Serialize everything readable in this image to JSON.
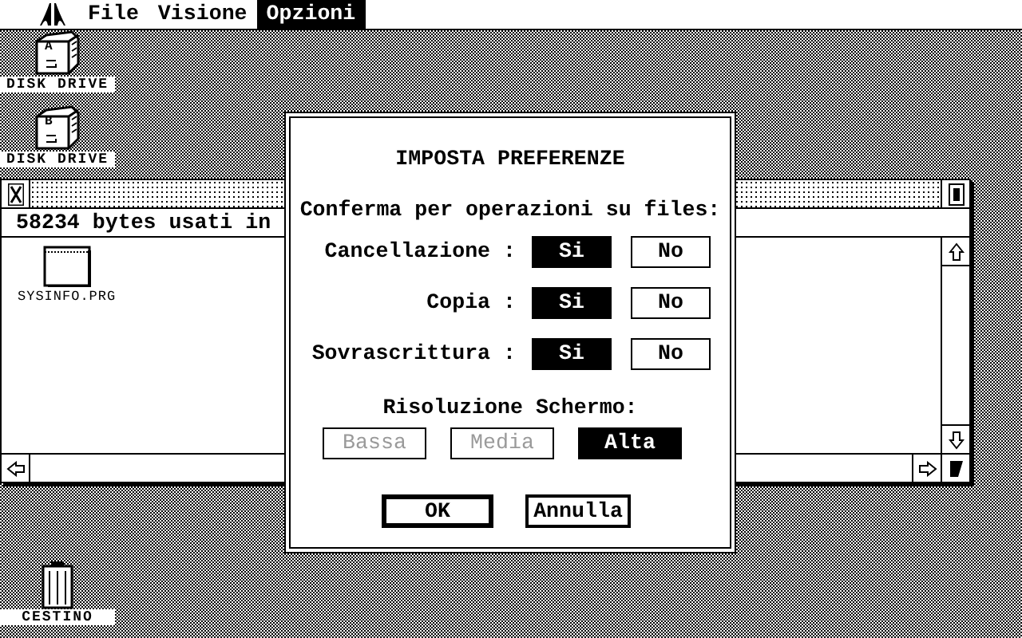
{
  "menu": [
    {
      "label": "File",
      "selected": false
    },
    {
      "label": "Visione",
      "selected": false
    },
    {
      "label": "Opzioni",
      "selected": true
    }
  ],
  "desktop_icons": [
    {
      "kind": "drive",
      "letter": "A",
      "label": "DISK DRIVE"
    },
    {
      "kind": "drive",
      "letter": "B",
      "label": "DISK DRIVE"
    },
    {
      "kind": "trash",
      "label": "CESTINO"
    }
  ],
  "window": {
    "info": "58234 bytes usati in",
    "files": [
      {
        "name": "SYSINFO.PRG"
      }
    ]
  },
  "dialog": {
    "title": "IMPOSTA PREFERENZE",
    "prompt": "Conferma per operazioni su files:",
    "rows": [
      {
        "label": "Cancellazione :",
        "options": [
          {
            "label": "Si",
            "selected": true
          },
          {
            "label": "No",
            "selected": false
          }
        ]
      },
      {
        "label": "Copia :",
        "options": [
          {
            "label": "Si",
            "selected": true
          },
          {
            "label": "No",
            "selected": false
          }
        ]
      },
      {
        "label": "Sovrascrittura :",
        "options": [
          {
            "label": "Si",
            "selected": true
          },
          {
            "label": "No",
            "selected": false
          }
        ]
      }
    ],
    "resolution": {
      "label": "Risoluzione Schermo:",
      "options": [
        {
          "label": "Bassa",
          "selected": false,
          "disabled": true
        },
        {
          "label": "Media",
          "selected": false,
          "disabled": true
        },
        {
          "label": "Alta",
          "selected": true,
          "disabled": false
        }
      ]
    },
    "buttons": [
      {
        "label": "OK",
        "default": true
      },
      {
        "label": "Annulla",
        "default": false
      }
    ]
  }
}
